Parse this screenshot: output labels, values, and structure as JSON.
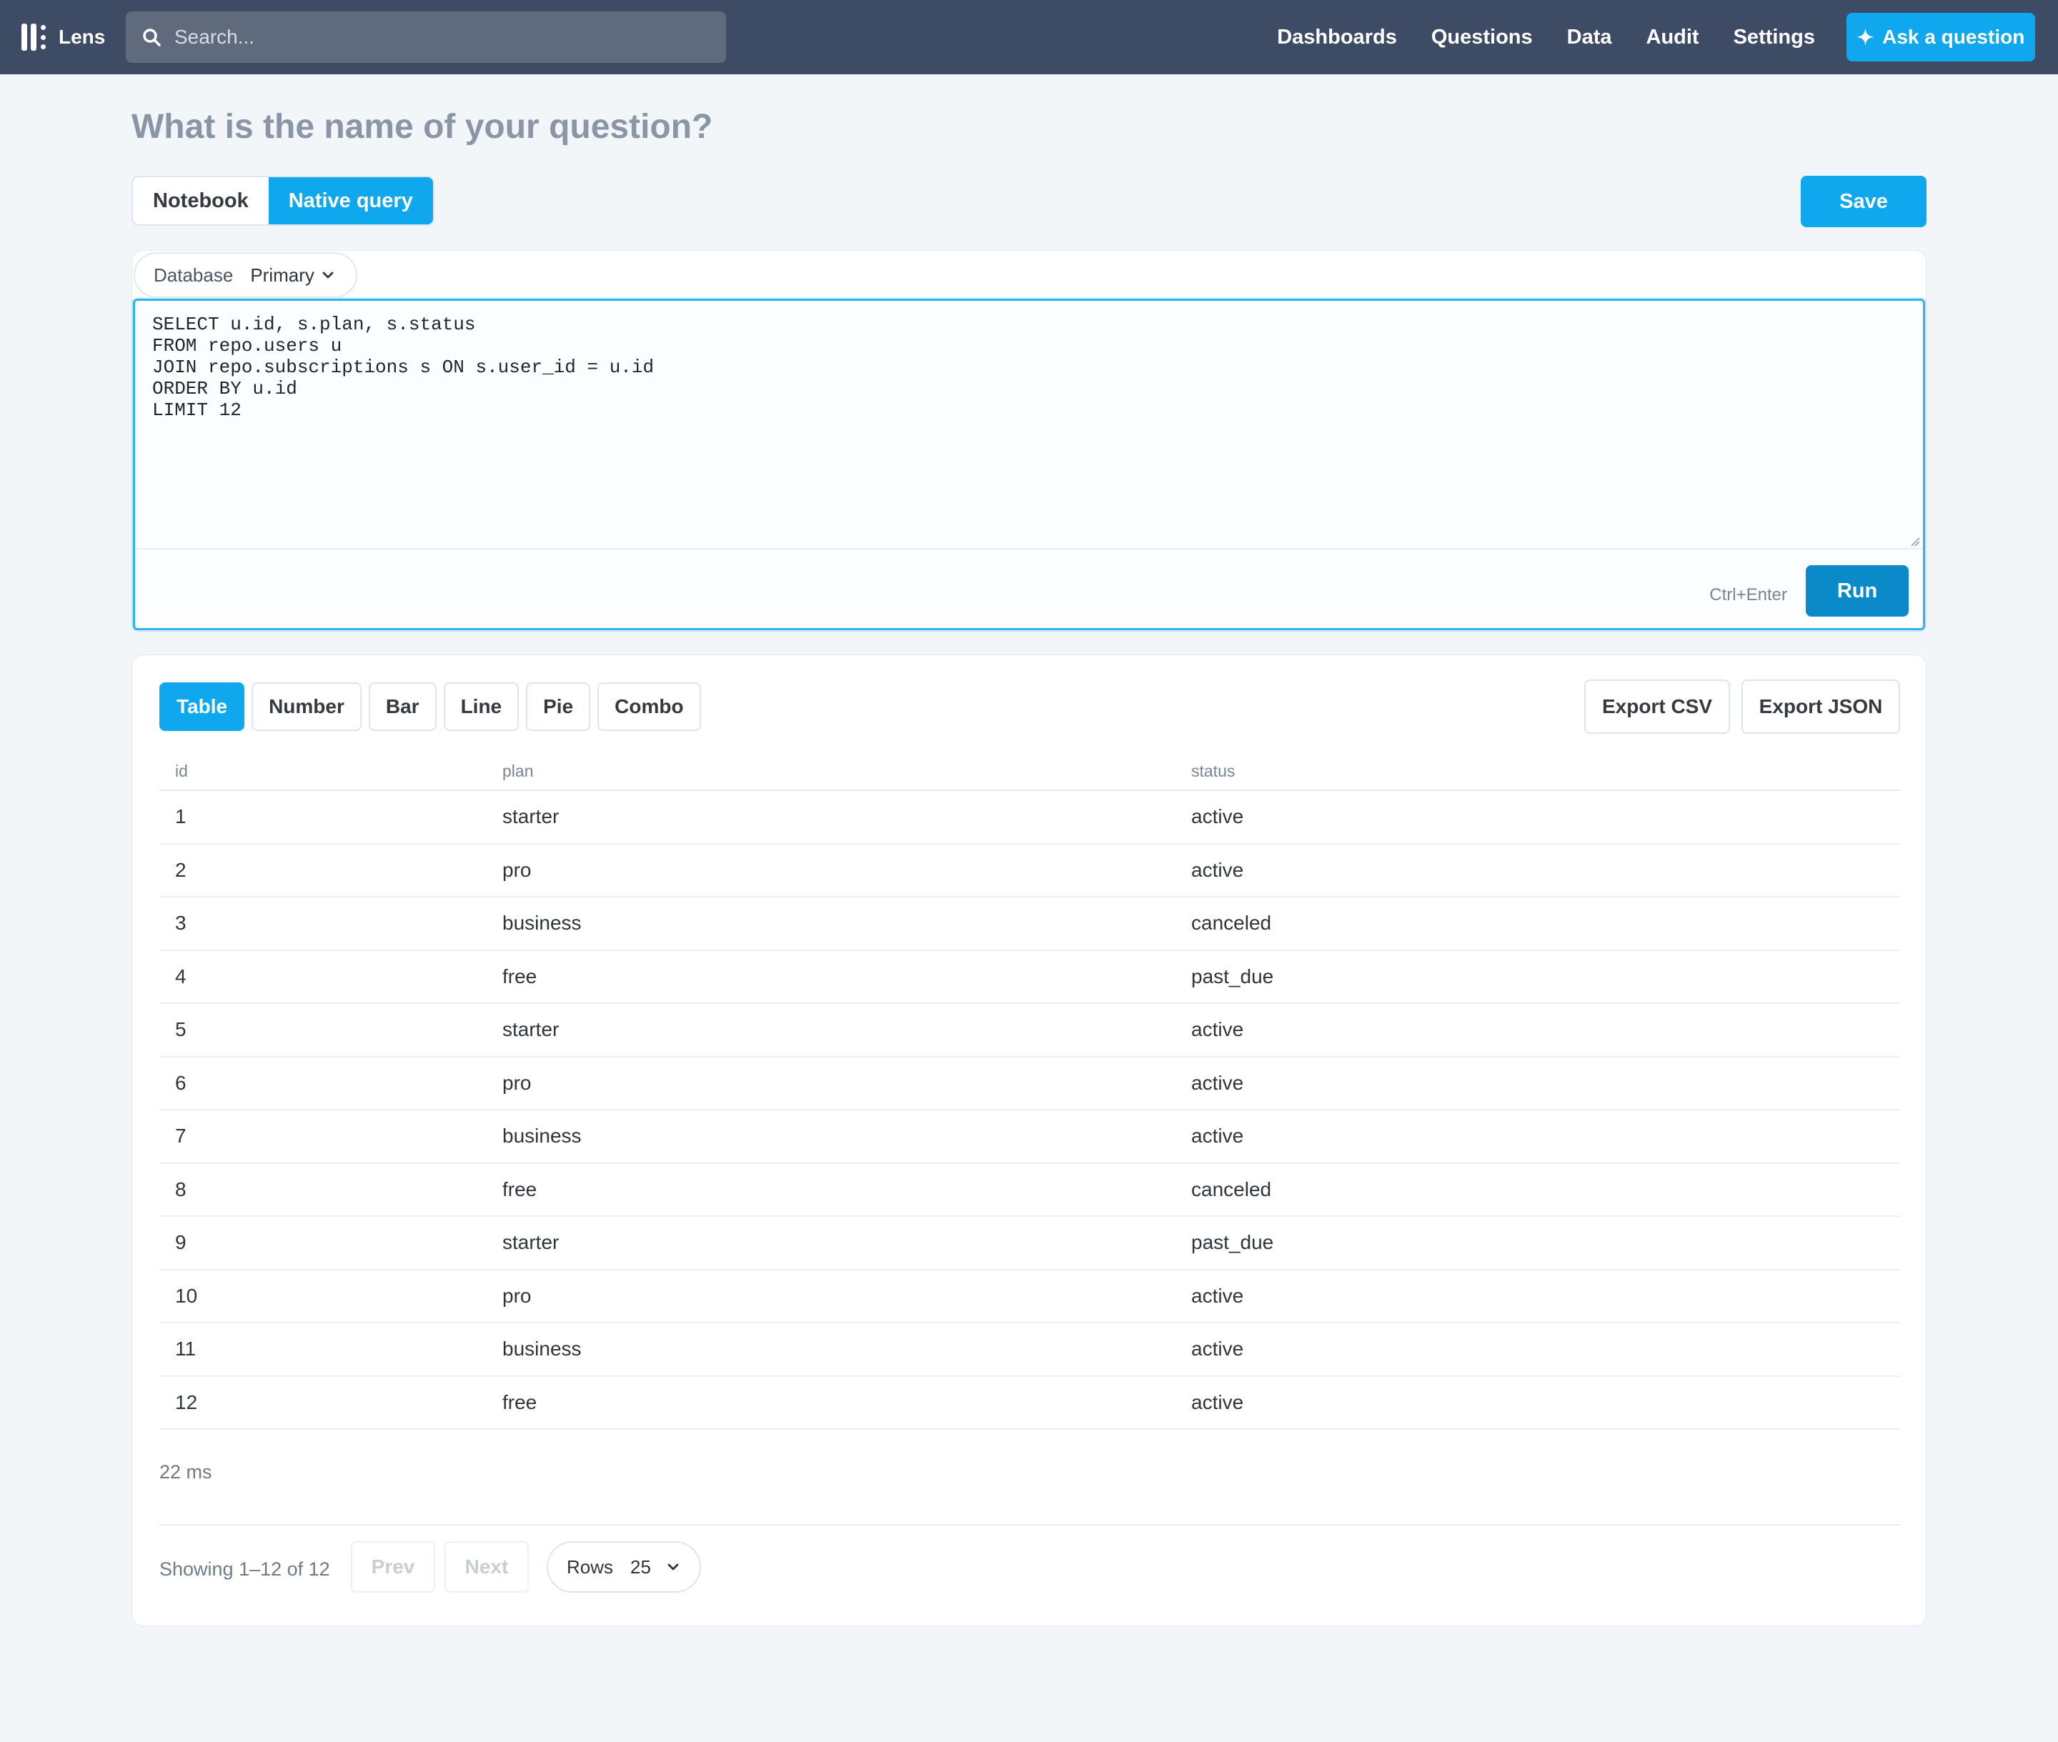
{
  "app": {
    "name": "Lens"
  },
  "search": {
    "placeholder": "Search..."
  },
  "nav": {
    "items": [
      "Dashboards",
      "Questions",
      "Data",
      "Audit",
      "Settings"
    ],
    "ask_label": "Ask a question"
  },
  "question": {
    "title_placeholder": "What is the name of your question?"
  },
  "mode": {
    "notebook": "Notebook",
    "native": "Native query",
    "save_label": "Save"
  },
  "editor": {
    "database_label": "Database",
    "database_value": "Primary",
    "sql": "SELECT u.id, s.plan, s.status\nFROM repo.users u\nJOIN repo.subscriptions s ON s.user_id = u.id\nORDER BY u.id\nLIMIT 12",
    "shortcut": "Ctrl+Enter",
    "run_label": "Run"
  },
  "viz": {
    "tabs": [
      "Table",
      "Number",
      "Bar",
      "Line",
      "Pie",
      "Combo"
    ],
    "active": "Table"
  },
  "export": {
    "csv": "Export CSV",
    "json": "Export JSON"
  },
  "table": {
    "columns": [
      "id",
      "plan",
      "status"
    ],
    "rows": [
      [
        "1",
        "starter",
        "active"
      ],
      [
        "2",
        "pro",
        "active"
      ],
      [
        "3",
        "business",
        "canceled"
      ],
      [
        "4",
        "free",
        "past_due"
      ],
      [
        "5",
        "starter",
        "active"
      ],
      [
        "6",
        "pro",
        "active"
      ],
      [
        "7",
        "business",
        "active"
      ],
      [
        "8",
        "free",
        "canceled"
      ],
      [
        "9",
        "starter",
        "past_due"
      ],
      [
        "10",
        "pro",
        "active"
      ],
      [
        "11",
        "business",
        "active"
      ],
      [
        "12",
        "free",
        "active"
      ]
    ]
  },
  "results": {
    "timing": "22 ms",
    "showing": "Showing 1–12 of 12",
    "prev": "Prev",
    "next": "Next",
    "rows_label": "Rows",
    "rows_value": "25"
  },
  "colors": {
    "topbar": "#3d4b64",
    "accent": "#0fa7ee",
    "run": "#0b8ac9",
    "editor_border": "#2bb3ec"
  }
}
